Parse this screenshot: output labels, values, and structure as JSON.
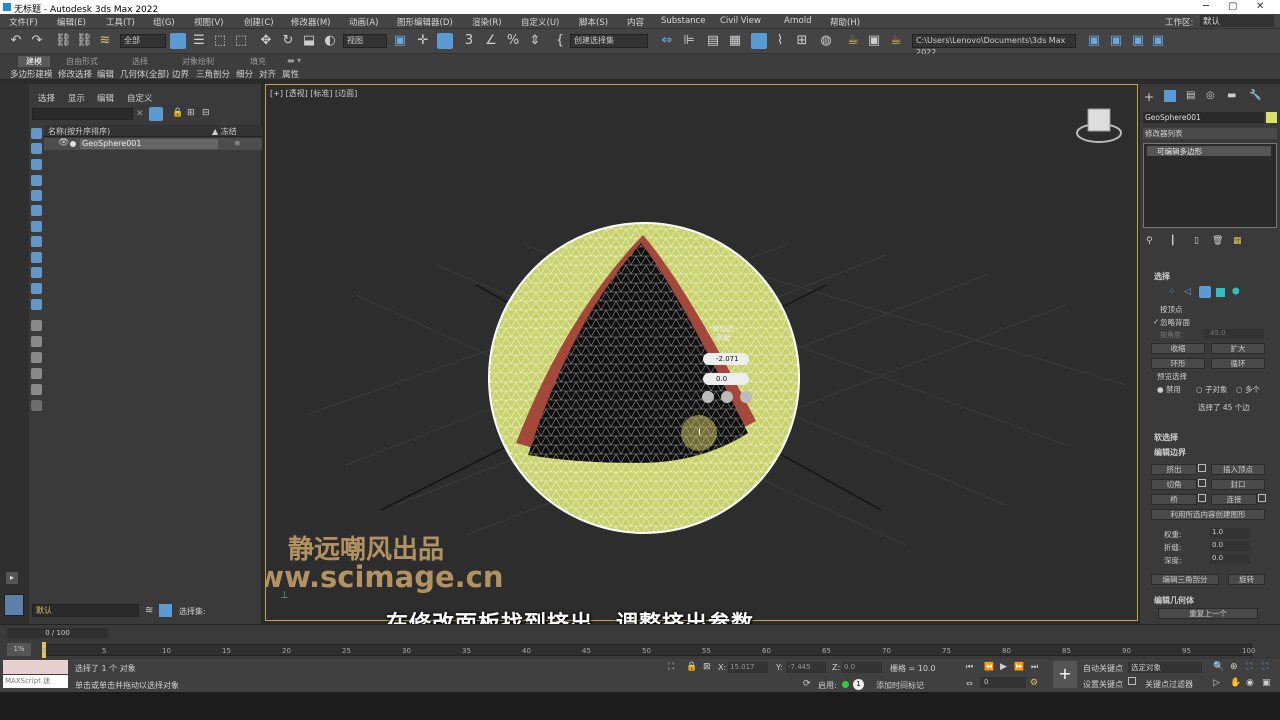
{
  "window": {
    "title": "无标题 - Autodesk 3ds Max 2022"
  },
  "menu": [
    "文件(F)",
    "编辑(E)",
    "工具(T)",
    "组(G)",
    "视图(V)",
    "创建(C)",
    "修改器(M)",
    "动画(A)",
    "图形编辑器(D)",
    "渲染(R)",
    "自定义(U)",
    "脚本(S)",
    "内容",
    "Substance",
    "Civil View",
    "Arnold",
    "帮助(H)"
  ],
  "workspace": {
    "label": "工作区:",
    "value": "默认"
  },
  "toolbar": {
    "filter": "全部",
    "view": "视图",
    "selset": "创建选择集",
    "path": "C:\\Users\\Lenovo\\Documents\\3ds Max 2022"
  },
  "ribbon": {
    "tabs": [
      "建模",
      "自由形式",
      "选择",
      "对象绘制",
      "填充"
    ],
    "subitems": [
      "多边形建模",
      "修改选择",
      "编辑",
      "几何体(全部)",
      "边界",
      "三角剖分",
      "细分",
      "对齐",
      "属性"
    ]
  },
  "scene": {
    "tabs": [
      "选择",
      "显示",
      "编辑",
      "自定义"
    ],
    "col_name": "名称(按升序排序)",
    "col_freeze": "▲ 冻结",
    "object": "GeoSphere001",
    "layer": "默认",
    "selset_label": "选择集:"
  },
  "viewport": {
    "label": "[+] [透视] [标准] [边面]",
    "caliper": {
      "title": "挤出边",
      "title2": "高度",
      "height": "-2.071",
      "width": "0.0"
    }
  },
  "watermark": {
    "line1": "静远嘲风出品",
    "line2": "www.scimage.cn"
  },
  "subtitle": "在修改面板找到挤出，调整挤出参数",
  "cmd": {
    "object_name": "GeoSphere001",
    "modifier_list": "修改器列表",
    "stack_item": "可编辑多边形",
    "select_rollout": "选择",
    "by_vertex": "按顶点",
    "ignore_back": "忽略背面",
    "by_angle": "按角度:",
    "angle": "45.0",
    "shrink": "收缩",
    "grow": "扩大",
    "ring": "环形",
    "loop": "循环",
    "preview": "预览选择",
    "disable": "禁用",
    "subobj": "子对象",
    "multi": "多个",
    "sel_count": "选择了 45 个边",
    "soft_sel": "软选择",
    "edit_border": "编辑边界",
    "extrude": "挤出",
    "insert_vertex": "插入顶点",
    "chamfer": "切角",
    "cap": "封口",
    "bridge": "桥",
    "connect": "连接",
    "create_shape": "利用所选内容创建图形",
    "weight_label": "权重:",
    "weight": "1.0",
    "crease_label": "折缝:",
    "crease": "0.0",
    "depth_label": "深度:",
    "depth": "0.0",
    "edit_tri": "编辑三角剖分",
    "turn": "旋转",
    "edit_geo": "编辑几何体",
    "repeat_last": "重复上一个"
  },
  "timeline": {
    "frame": "0 / 100",
    "ticks": [
      "0",
      "5",
      "10",
      "15",
      "20",
      "25",
      "30",
      "35",
      "40",
      "45",
      "50",
      "55",
      "60",
      "65",
      "70",
      "75",
      "80",
      "85",
      "90",
      "95",
      "100"
    ]
  },
  "status": {
    "maxscript": "MAXScript 迷",
    "selected": "选择了 1 个 对象",
    "hint": "单击或单击并拖动以选择对象",
    "x_label": "X:",
    "x": "15.017",
    "y_label": "Y:",
    "y": "-7.445",
    "z_label": "Z:",
    "z": "0.0",
    "grid": "栅格 = 10.0",
    "enable": "启用:",
    "add_time_tag": "添加时间标记",
    "auto_key": "自动关键点",
    "set_key": "设置关键点",
    "selected_obj": "选定对象",
    "key_filters": "关键点过滤器",
    "frame_field": "0"
  }
}
